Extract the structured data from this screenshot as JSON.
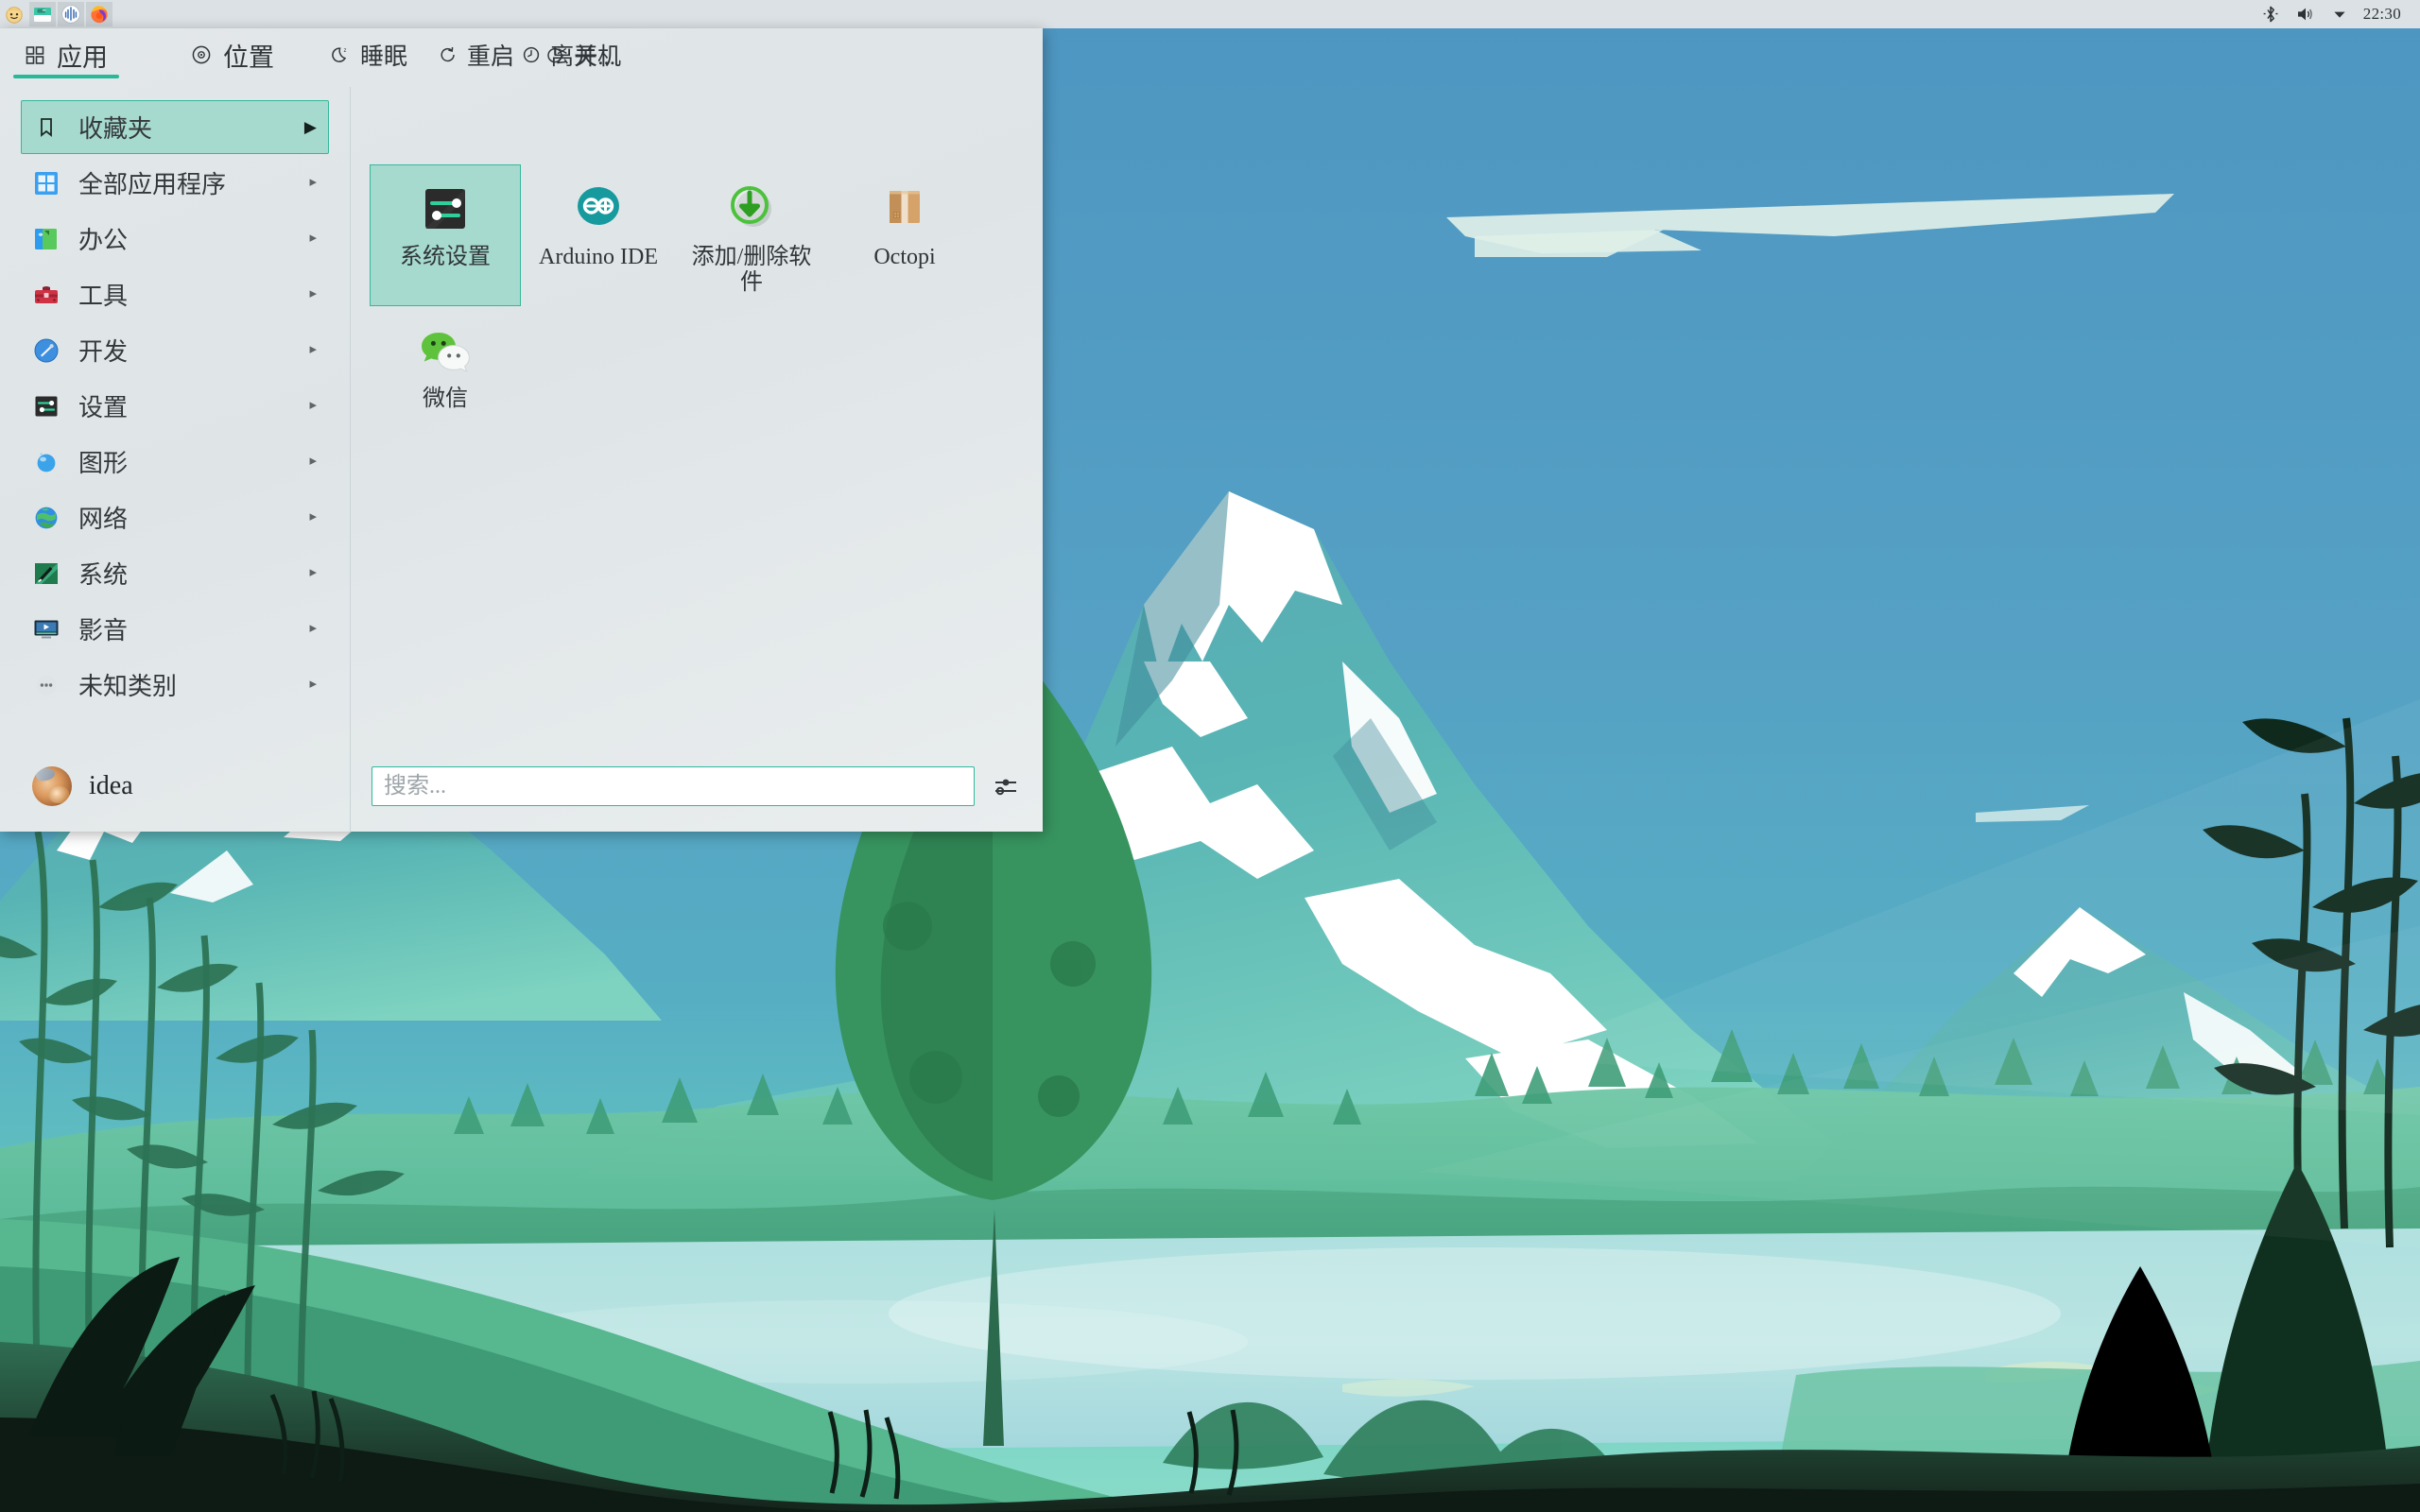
{
  "panel": {
    "launchers": [
      {
        "name": "user-face-icon",
        "title": "face"
      },
      {
        "name": "file-manager-icon",
        "title": "file-manager"
      },
      {
        "name": "app-blue-icon",
        "title": "seahorse"
      },
      {
        "name": "firefox-icon",
        "title": "Firefox"
      }
    ],
    "status": {
      "bluetooth_icon": "bluetooth-icon",
      "volume_icon": "volume-icon",
      "chevron_icon": "chevron-down-icon",
      "clock": "22:30"
    }
  },
  "menu": {
    "tabs": [
      {
        "label": "应用",
        "icon": "grid-icon",
        "active": true
      },
      {
        "label": "位置",
        "icon": "compass-icon",
        "active": false
      }
    ],
    "session_buttons": [
      {
        "label": "睡眠",
        "icon": "moon-icon"
      },
      {
        "label": "重启",
        "icon": "restart-icon"
      },
      {
        "label": "关机",
        "icon": "power-icon"
      }
    ],
    "leave_button": {
      "label": "离开...",
      "icon": "clock-icon"
    },
    "categories": [
      {
        "label": "收藏夹",
        "icon": "bookmark-icon",
        "selected": true
      },
      {
        "label": "全部应用程序",
        "icon": "all-apps-icon",
        "selected": false
      },
      {
        "label": "办公",
        "icon": "office-icon",
        "selected": false
      },
      {
        "label": "工具",
        "icon": "toolbox-icon",
        "selected": false
      },
      {
        "label": "开发",
        "icon": "development-icon",
        "selected": false
      },
      {
        "label": "设置",
        "icon": "settings-icon",
        "selected": false
      },
      {
        "label": "图形",
        "icon": "graphics-icon",
        "selected": false
      },
      {
        "label": "网络",
        "icon": "network-icon",
        "selected": false
      },
      {
        "label": "系统",
        "icon": "system-icon",
        "selected": false
      },
      {
        "label": "影音",
        "icon": "multimedia-icon",
        "selected": false
      },
      {
        "label": "未知类别",
        "icon": "unknown-category-icon",
        "selected": false
      }
    ],
    "apps": [
      {
        "label": "系统设置",
        "icon": "system-settings-icon",
        "selected": true
      },
      {
        "label": "Arduino IDE",
        "icon": "arduino-icon",
        "selected": false
      },
      {
        "label": "添加/删除软件",
        "icon": "add-remove-software-icon",
        "selected": false
      },
      {
        "label": "Octopi",
        "icon": "octopi-package-icon",
        "selected": false
      },
      {
        "label": "微信",
        "icon": "wechat-icon",
        "selected": false
      }
    ],
    "user": {
      "name": "idea",
      "avatar": "user-avatar"
    },
    "search": {
      "value": "",
      "placeholder": "搜索..."
    },
    "settings_button": {
      "icon": "sliders-icon"
    }
  },
  "colors": {
    "panel_bg": "#dbe1e4",
    "menu_bg": "#e2e7e9",
    "accent": "#27b99a",
    "selection_bg": "#a7dace",
    "selection_border": "#35b79c",
    "text": "#2f3538"
  },
  "desktop": {
    "wallpaper": "mountain-lake-bamboo-illustration"
  }
}
